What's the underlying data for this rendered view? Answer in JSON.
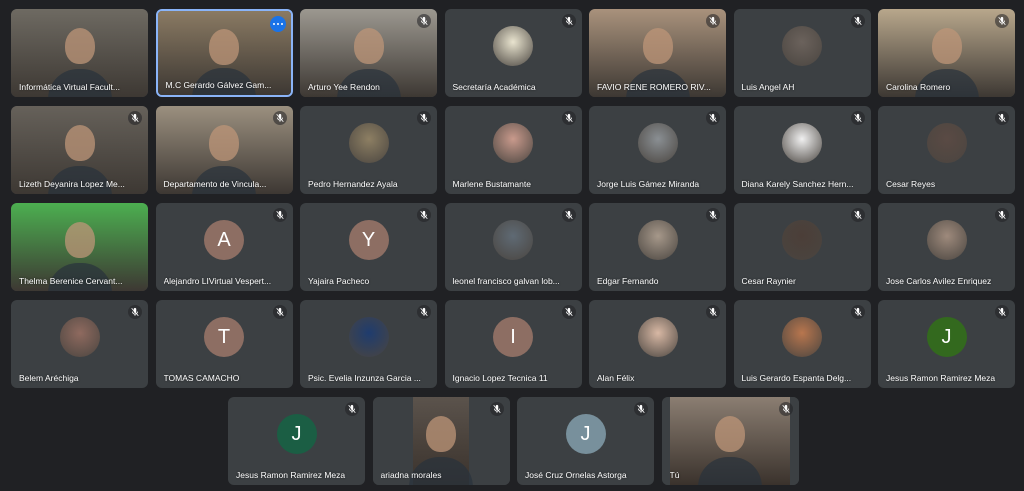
{
  "participants": [
    {
      "name": "Informática Virtual Facult...",
      "kind": "video",
      "muted": false,
      "bg": "#6e6a62"
    },
    {
      "name": "M.C Gerardo Gálvez Gam...",
      "kind": "video",
      "muted": false,
      "speaking": true,
      "more": true,
      "bg": "#8a7a63"
    },
    {
      "name": "Arturo Yee Rendon",
      "kind": "video",
      "muted": true,
      "bg": "#9c9890"
    },
    {
      "name": "Secretaría Académica",
      "kind": "photo",
      "muted": true,
      "photo": "#e9e4cf"
    },
    {
      "name": "FAVIO RENE ROMERO RIV...",
      "kind": "video",
      "muted": true,
      "bg": "#a9927c"
    },
    {
      "name": "Luis Angel AH",
      "kind": "photo",
      "muted": true,
      "photo": "#6b625c"
    },
    {
      "name": "Carolina Romero",
      "kind": "video",
      "muted": true,
      "bg": "#b8a78c"
    },
    {
      "name": "Lizeth Deyanira Lopez Me...",
      "kind": "video",
      "muted": true,
      "bg": "#66615a"
    },
    {
      "name": "Departamento de Vincula...",
      "kind": "video",
      "muted": true,
      "bg": "#9b907f"
    },
    {
      "name": "Pedro Hernandez Ayala",
      "kind": "photo",
      "muted": true,
      "photo": "#8d7f63"
    },
    {
      "name": "Marlene Bustamante",
      "kind": "photo",
      "muted": true,
      "photo": "#c99a8c"
    },
    {
      "name": "Jorge Luis Gámez Miranda",
      "kind": "photo",
      "muted": true,
      "photo": "#8a8f93"
    },
    {
      "name": "Diana Karely Sanchez Hern...",
      "kind": "photo",
      "muted": true,
      "photo": "#f0f0f0"
    },
    {
      "name": "Cesar Reyes",
      "kind": "photo",
      "muted": true,
      "photo": "#5a4a44"
    },
    {
      "name": "Thelma Berenice Cervant...",
      "kind": "video",
      "muted": false,
      "bg": "#4caf50"
    },
    {
      "name": "Alejandro LIVirtual Vespert...",
      "kind": "letter",
      "letter": "A",
      "muted": true,
      "color": "#8d6e63"
    },
    {
      "name": "Yajaira Pacheco",
      "kind": "letter",
      "letter": "Y",
      "muted": true,
      "color": "#8d6e63"
    },
    {
      "name": "leonel francisco galvan lob...",
      "kind": "photo",
      "muted": true,
      "photo": "#5f6a74"
    },
    {
      "name": "Edgar Fernando",
      "kind": "photo",
      "muted": true,
      "photo": "#a6988a"
    },
    {
      "name": "Cesar Raynier",
      "kind": "photo",
      "muted": true,
      "photo": "#4b3e38"
    },
    {
      "name": "Jose Carlos Avilez Enriquez",
      "kind": "photo",
      "muted": true,
      "photo": "#9e8a7c"
    },
    {
      "name": "Belem Aréchiga",
      "kind": "photo",
      "muted": true,
      "photo": "#8f6a5f"
    },
    {
      "name": "TOMAS CAMACHO",
      "kind": "letter",
      "letter": "T",
      "muted": true,
      "color": "#8d6e63"
    },
    {
      "name": "Psic. Evelia Inzunza Garcia ...",
      "kind": "photo",
      "muted": true,
      "photo": "#1f3c6e"
    },
    {
      "name": "Ignacio Lopez Tecnica 11",
      "kind": "letter",
      "letter": "I",
      "muted": true,
      "color": "#8d6e63"
    },
    {
      "name": "Alan Félix",
      "kind": "photo",
      "muted": true,
      "photo": "#d8b8a4"
    },
    {
      "name": "Luis Gerardo Espanta Delg...",
      "kind": "photo",
      "muted": true,
      "photo": "#b8764e"
    },
    {
      "name": "Jesus Ramon Ramirez Meza",
      "kind": "letter",
      "letter": "J",
      "muted": true,
      "color": "#33691e"
    },
    {
      "name": "Jesus Ramon Ramirez Meza",
      "kind": "letter",
      "letter": "J",
      "muted": true,
      "color": "#1b5e44"
    },
    {
      "name": "ariadna morales",
      "kind": "video",
      "muted": true,
      "bg": "#5b534c",
      "narrow": true
    },
    {
      "name": "José Cruz Ornelas Astorga",
      "kind": "letter",
      "letter": "J",
      "muted": true,
      "color": "#78909c"
    },
    {
      "name": "Tú",
      "kind": "video",
      "muted": true,
      "bg": "#8b7e72",
      "narrow": true
    }
  ]
}
